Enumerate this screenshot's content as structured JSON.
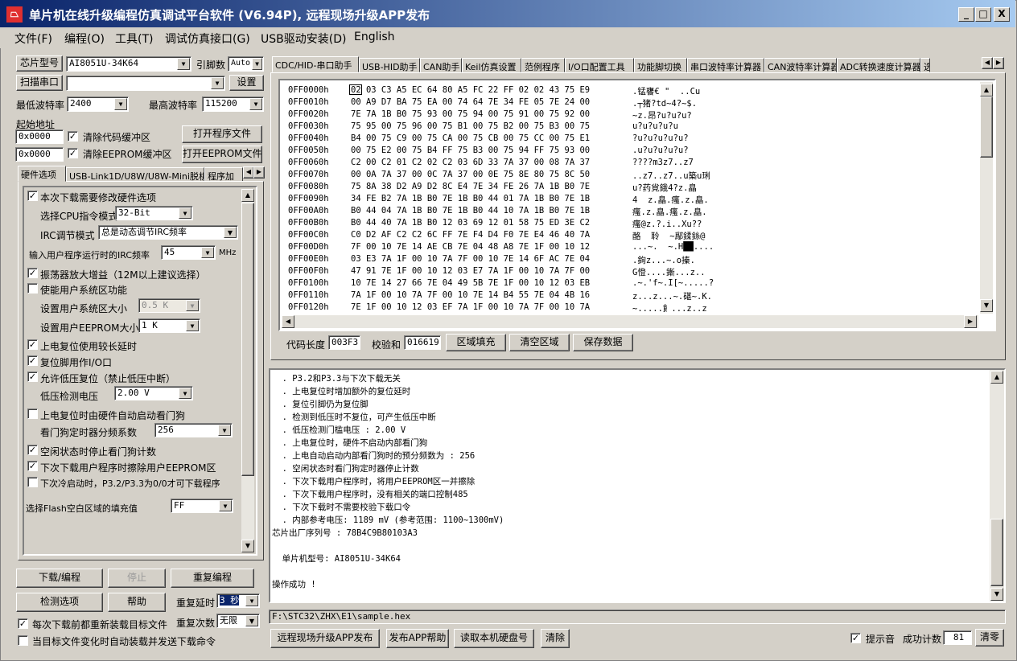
{
  "window": {
    "title": "单片机在线升级编程仿真调试平台软件 (V6.94P), 远程现场升级APP发布",
    "icon_glyph": "⏢",
    "controls": [
      "_",
      "□",
      "X"
    ]
  },
  "menu": [
    "文件(F)",
    "编程(O)",
    "工具(T)",
    "调试仿真接口(G)",
    "USB驱动安装(D)",
    "English"
  ],
  "left": {
    "chip_model_btn": "芯片型号",
    "chip_model": "AI8051U-34K64",
    "pin_count_label": "引脚数",
    "pin_count": "Auto",
    "scan_port_btn": "扫描串口",
    "port_value": "",
    "settings_btn": "设置",
    "min_baud_label": "最低波特率",
    "min_baud": "2400",
    "max_baud_label": "最高波特率",
    "max_baud": "115200",
    "start_addr_label": "起始地址",
    "addr1": "0x0000",
    "clear_code_label": "清除代码缓冲区",
    "open_prog_btn": "打开程序文件",
    "addr2": "0x0000",
    "clear_eeprom_label": "清除EEPROM缓冲区",
    "open_eeprom_btn": "打开EEPROM文件",
    "tabs": [
      "硬件选项",
      "USB-Link1D/U8W/U8W-Mini脱机",
      "程序加"
    ],
    "options": {
      "modify_hw": "本次下载需要修改硬件选项",
      "cpu_mode_label": "选择CPU指令模式",
      "cpu_mode": "32-Bit",
      "irc_mode_label": "IRC调节模式",
      "irc_mode": "总是动态调节IRC频率",
      "irc_freq_label": "输入用户程序运行时的IRC频率",
      "irc_freq": "45",
      "mhz": "MHz",
      "osc_gain": "振荡器放大增益（12M以上建议选择）",
      "user_sys_area": "使能用户系统区功能",
      "sys_area_size_label": "设置用户系统区大小",
      "sys_area_size": "0.5 K",
      "eeprom_size_label": "设置用户EEPROM大小",
      "eeprom_size": "1   K",
      "long_reset_delay": "上电复位使用较长延时",
      "reset_pin_io": "复位脚用作I/O口",
      "low_volt_reset": "允许低压复位（禁止低压中断）",
      "low_volt_label": "低压检测电压",
      "low_volt": "2.00 V",
      "wdt_auto": "上电复位时由硬件自动启动看门狗",
      "wdt_div_label": "看门狗定时器分频系数",
      "wdt_div": "256",
      "idle_wdt_stop": "空闲状态时停止看门狗计数",
      "erase_eeprom": "下次下载用户程序时擦除用户EEPROM区",
      "cold_boot": "下次冷启动时，P3.2/P3.3为0/0才可下载程序",
      "fill_label": "选择Flash空白区域的填充值",
      "fill_value": "FF"
    },
    "download_btn": "下载/编程",
    "stop_btn": "停止",
    "repeat_prog_btn": "重复编程",
    "check_btn": "检测选项",
    "help_btn": "帮助",
    "repeat_delay_label": "重复延时",
    "repeat_delay": "3 秒",
    "repeat_count_label": "重复次数",
    "repeat_count": "无限",
    "reload_label": "每次下载前都重新装载目标文件",
    "auto_send_label": "当目标文件变化时自动装载并发送下载命令"
  },
  "right": {
    "tabs": [
      "CDC/HID-串口助手",
      "USB-HID助手",
      "CAN助手",
      "Keil仿真设置",
      "范例程序",
      "I/O口配置工具",
      "功能脚切换",
      "串口波特率计算器",
      "CAN波特率计算器",
      "ADC转换速度计算器",
      "选"
    ],
    "hex_rows": [
      [
        "0FF0000h",
        "02 03 C3 A5 EC 64 80 A5 FC 22 FF 02 02 43 75 E9",
        ".锰饔€ \"  ..Cu"
      ],
      [
        "0FF0010h",
        "00 A9 D7 BA 75 EA 00 74 64 7E 34 FE 05 7E 24 00",
        ".┬猪?td~4?~$."
      ],
      [
        "0FF0020h",
        "7E 7A 1B B0 75 93 00 75 94 00 75 91 00 75 92 00",
        "~z.昂?u?u?u?"
      ],
      [
        "0FF0030h",
        "75 95 00 75 96 00 75 B1 00 75 B2 00 75 B3 00 75",
        "u?u?u?u?u"
      ],
      [
        "0FF0040h",
        "B4 00 75 C9 00 75 CA 00 75 CB 00 75 CC 00 75 E1",
        "?u?u?u?u?u?"
      ],
      [
        "0FF0050h",
        "00 75 E2 00 75 B4 FF 75 B3 00 75 94 FF 75 93 00",
        ".u?u?u?u?u?"
      ],
      [
        "0FF0060h",
        "C2 00 C2 01 C2 02 C2 03 6D 33 7A 37 00 08 7A 37",
        "????m3z7..z7"
      ],
      [
        "0FF0070h",
        "00 0A 7A 37 00 0C 7A 37 00 0E 75 8E 80 75 8C 50",
        "..z7..z7..u築u琍"
      ],
      [
        "0FF0080h",
        "75 8A 38 D2 A9 D2 8C E4 7E 34 FE 26 7A 1B B0 7E",
        "u?药覍鋨4?z.皛"
      ],
      [
        "0FF0090h",
        "34 FE B2 7A 1B B0 7E 1B B0 44 01 7A 1B B0 7E 1B",
        "4  z.皛.瘙.z.皛."
      ],
      [
        "0FF00A0h",
        "B0 44 04 7A 1B B0 7E 1B B0 44 10 7A 1B B0 7E 1B",
        "瘙.z.皛.瘙.z.皛."
      ],
      [
        "0FF00B0h",
        "B0 44 40 7A 1B B0 12 03 69 12 01 58 75 ED 3E C2",
        "瘙@z.?.i..Xu??"
      ],
      [
        "0FF00C0h",
        "C0 D2 AF C2 C2 6C FF 7E F4 D4 F0 7E E4 46 40 7A",
        "酪  聆  ~鄬鍒銯@"
      ],
      [
        "0FF00D0h",
        "7F 00 10 7E 14 AE CB 7E 04 48 A8 7E 1F 00 10 12",
        "...~.  ~.H██...."
      ],
      [
        "0FF00E0h",
        "03 E3 7A 1F 00 10 7A 7F 00 10 7E 14 6F AC 7E 04",
        ".銁z...~.o搸."
      ],
      [
        "0FF00F0h",
        "47 91 7E 1F 00 10 12 03 E7 7A 1F 00 10 7A 7F 00",
        "G憕....鏩...z.."
      ],
      [
        "0FF0100h",
        "10 7E 14 27 66 7E 04 49 5B 7E 1F 00 10 12 03 EB",
        ".~.'f~.I[~.....?"
      ],
      [
        "0FF0110h",
        "7A 1F 00 10 7A 7F 00 10 7E 14 B4 55 7E 04 4B 16",
        "z...z...~.碪~.K."
      ],
      [
        "0FF0120h",
        "7E 1F 00 10 12 03 EF 7A 1F 00 10 7A 7F 00 10 7A",
        "~.....飠...z..z"
      ]
    ],
    "code_len_label": "代码长度",
    "code_len": "003F3",
    "checksum_label": "校验和",
    "checksum": "016619",
    "fill_btn": "区域填充",
    "clear_area_btn": "清空区域",
    "save_btn": "保存数据",
    "log_lines": [
      "  . P3.2和P3.3与下次下载无关",
      "  . 上电复位时增加额外的复位延时",
      "  . 复位引脚仍为复位脚",
      "  . 检测到低压时不复位，可产生低压中断",
      "  . 低压检测门槛电压 : 2.00 V",
      "  . 上电复位时，硬件不启动内部看门狗",
      "  . 上电自动启动内部看门狗时的预分频数为 : 256",
      "  . 空闲状态时看门狗定时器停止计数",
      "  . 下次下载用户程序时，将用户EEPROM区一并擦除",
      "  . 下次下载用户程序时，没有相关的端口控制485",
      "  . 下次下载时不需要校验下载口令",
      "  . 内部参考电压: 1189 mV (参考范围: 1100~1300mV)",
      "芯片出厂序列号 : 78B4C9B80103A3",
      "",
      "  单片机型号: AI8051U-34K64",
      "",
      "操作成功 !"
    ],
    "file_path": "F:\\STC32\\ZHX\\E1\\sample.hex",
    "remote_btn": "远程现场升级APP发布",
    "publish_help_btn": "发布APP帮助",
    "read_disk_btn": "读取本机硬盘号",
    "clear_btn": "清除",
    "beep_label": "提示音",
    "success_label": "成功计数",
    "success_count": "81",
    "reset_btn": "清零"
  }
}
